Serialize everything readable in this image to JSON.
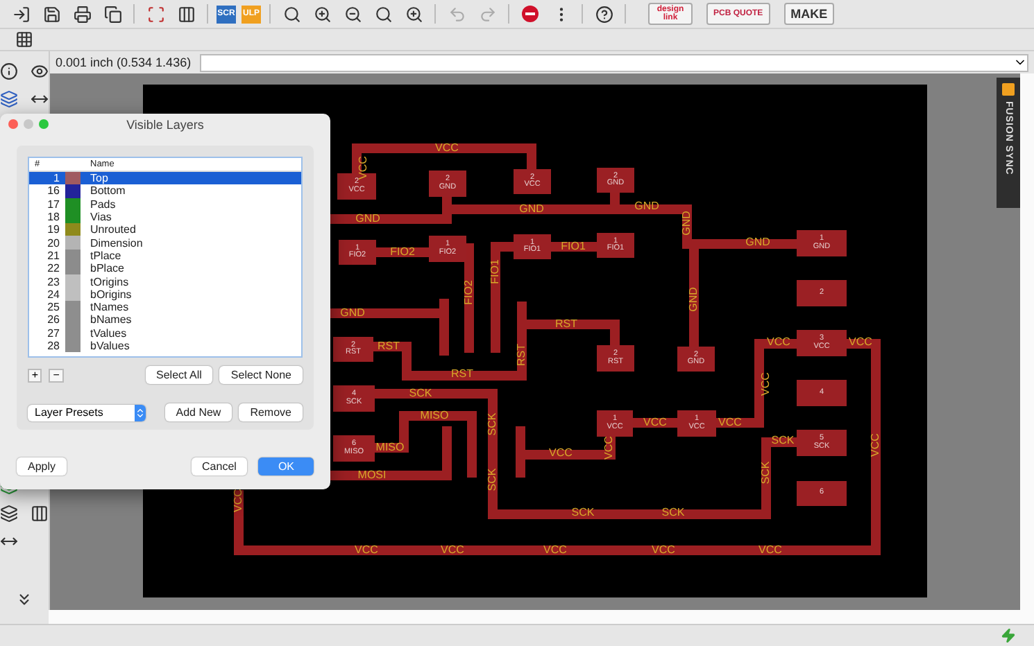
{
  "toolbar": {
    "script_buttons": [
      "SCR",
      "ULP"
    ],
    "vendor_buttons": [
      {
        "kind": "designlink",
        "label": "design link"
      },
      {
        "kind": "quote",
        "label": "PCB QUOTE"
      },
      {
        "kind": "make",
        "label": "MAKE"
      }
    ]
  },
  "coordinates": "0.001 inch (0.534 1.436)",
  "fusion_tab": "FUSION SYNC",
  "board": {
    "pads": [
      {
        "number": "2",
        "net": "VCC"
      },
      {
        "number": "2",
        "net": "GND"
      },
      {
        "number": "2",
        "net": "VCC"
      },
      {
        "number": "2",
        "net": "GND"
      },
      {
        "number": "1",
        "net": "FIO2"
      },
      {
        "number": "1",
        "net": "FIO2"
      },
      {
        "number": "1",
        "net": "FIO1"
      },
      {
        "number": "1",
        "net": "FIO1"
      },
      {
        "number": "1",
        "net": "GND"
      },
      {
        "number": "2"
      },
      {
        "number": "2",
        "net": "RST"
      },
      {
        "number": "2",
        "net": "RST"
      },
      {
        "number": "2",
        "net": "GND"
      },
      {
        "number": "3",
        "net": "VCC"
      },
      {
        "number": "4",
        "net": "SCK"
      },
      {
        "number": "4"
      },
      {
        "number": "1",
        "net": "VCC"
      },
      {
        "number": "1",
        "net": "VCC"
      },
      {
        "number": "6",
        "net": "MISO"
      },
      {
        "number": "5",
        "net": "SCK"
      },
      {
        "number": "6"
      }
    ],
    "trace_labels": [
      "VCC",
      "VCC",
      "GND",
      "GND",
      "GND",
      "GND",
      "GND",
      "GND",
      "FIO2",
      "FIO2",
      "FIO1",
      "FIO1",
      "GND",
      "RST",
      "RST",
      "RST",
      "RST",
      "SCK",
      "SCK",
      "SCK",
      "SCK",
      "SCK",
      "SCK",
      "SCK",
      "MISO",
      "MISO",
      "MOSI",
      "VCC",
      "VCC",
      "VCC",
      "VCC",
      "VCC",
      "VCC",
      "VCC",
      "VCC",
      "VCC",
      "VCC",
      "VCC",
      "VCC",
      "VCC",
      "VCC"
    ]
  },
  "dialog": {
    "title": "Visible Layers",
    "columns": [
      "#",
      "Name"
    ],
    "layers": [
      {
        "number": "1",
        "name": "Top",
        "color": "#a05a60",
        "selected": true
      },
      {
        "number": "16",
        "name": "Bottom",
        "color": "#23239a",
        "selected": false
      },
      {
        "number": "17",
        "name": "Pads",
        "color": "#1f8f24",
        "selected": false
      },
      {
        "number": "18",
        "name": "Vias",
        "color": "#1f8f24",
        "selected": false
      },
      {
        "number": "19",
        "name": "Unrouted",
        "color": "#8f8a1c",
        "selected": false
      },
      {
        "number": "20",
        "name": "Dimension",
        "color": "#b4b4b4",
        "selected": false
      },
      {
        "number": "21",
        "name": "tPlace",
        "color": "#8c8c8c",
        "selected": false
      },
      {
        "number": "22",
        "name": "bPlace",
        "color": "#8c8c8c",
        "selected": false
      },
      {
        "number": "23",
        "name": "tOrigins",
        "color": "#bfbfbf",
        "selected": false
      },
      {
        "number": "24",
        "name": "bOrigins",
        "color": "#bfbfbf",
        "selected": false
      },
      {
        "number": "25",
        "name": "tNames",
        "color": "#8e8e8e",
        "selected": false
      },
      {
        "number": "26",
        "name": "bNames",
        "color": "#8e8e8e",
        "selected": false
      },
      {
        "number": "27",
        "name": "tValues",
        "color": "#8e8e8e",
        "selected": false
      },
      {
        "number": "28",
        "name": "bValues",
        "color": "#8e8e8e",
        "selected": false
      }
    ],
    "add_remove": [
      "+",
      "−"
    ],
    "select_buttons": [
      "Select All",
      "Select None"
    ],
    "presets": {
      "value": "Layer Presets"
    },
    "preset_buttons": [
      "Add New",
      "Remove"
    ],
    "apply": "Apply",
    "cancel": "Cancel",
    "ok": "OK"
  }
}
